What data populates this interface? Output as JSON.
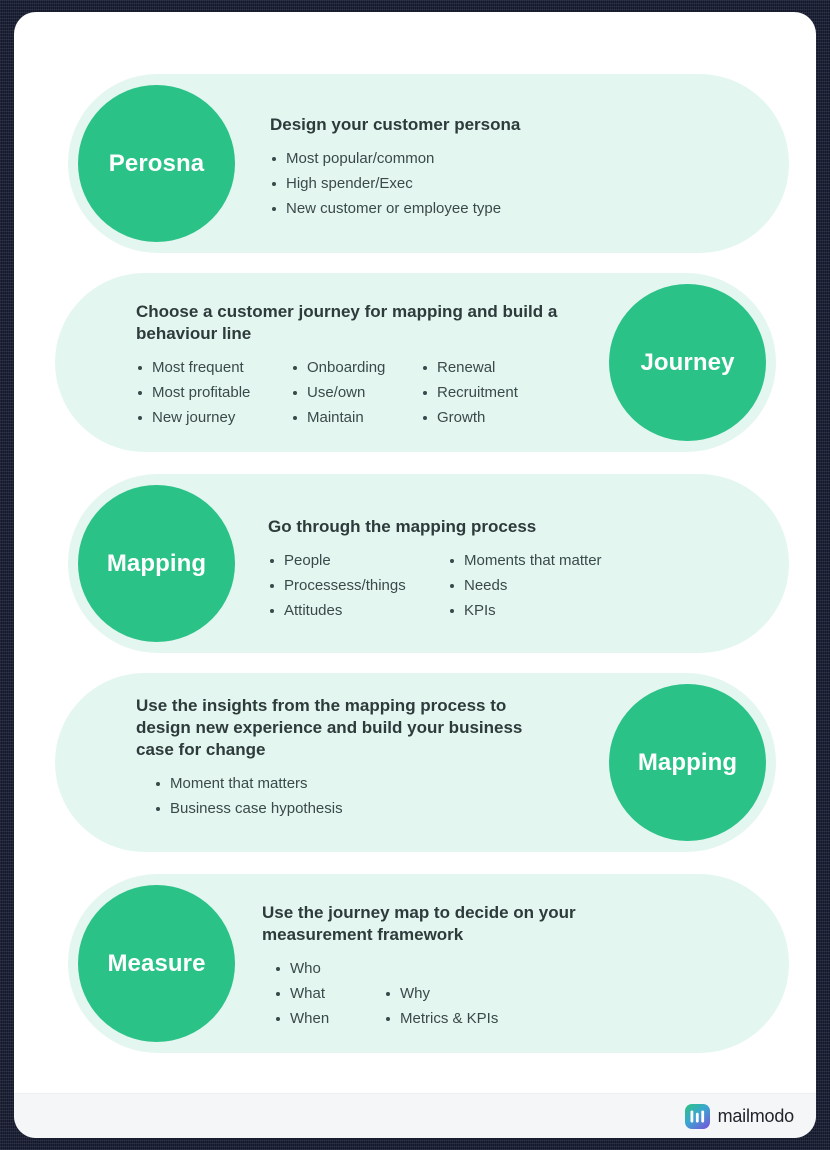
{
  "document": {
    "type": "infographic",
    "theme": {
      "accent_green": "#2ac287",
      "panel_bg": "#e4f6f0",
      "page_bg": "#ffffff",
      "heading_color": "#2d3b3b",
      "body_color": "#3a4a4a",
      "footer_bg": "#f5f6f7"
    }
  },
  "sections": [
    {
      "badge": "Perosna",
      "badge_side": "left",
      "title": "Design your customer persona",
      "columns": [
        {
          "items": [
            "Most popular/common",
            "High spender/Exec",
            "New customer or employee type"
          ]
        }
      ]
    },
    {
      "badge": "Journey",
      "badge_side": "right",
      "title": "Choose a customer journey for mapping and build a behaviour line",
      "columns": [
        {
          "items": [
            "Most frequent",
            "Most profitable",
            "New journey"
          ]
        },
        {
          "items": [
            "Onboarding",
            "Use/own",
            "Maintain"
          ]
        },
        {
          "items": [
            "Renewal",
            "Recruitment",
            "Growth"
          ]
        }
      ]
    },
    {
      "badge": "Mapping",
      "badge_side": "left",
      "title": "Go through the mapping process",
      "columns": [
        {
          "items": [
            "People",
            "Processess/things",
            "Attitudes"
          ]
        },
        {
          "items": [
            "Moments that matter",
            "Needs",
            "KPIs"
          ]
        }
      ]
    },
    {
      "badge": "Mapping",
      "badge_side": "right",
      "title": "Use the insights from the mapping process to design new experience and build your business case for change",
      "columns": [
        {
          "items": [
            "Moment that matters",
            "Business case hypothesis"
          ]
        }
      ]
    },
    {
      "badge": "Measure",
      "badge_side": "left",
      "title": "Use the journey map to decide on your measurement framework",
      "columns": [
        {
          "items": [
            "Who",
            "What",
            "When"
          ]
        },
        {
          "items": [
            "",
            "Why",
            "Metrics & KPIs"
          ]
        }
      ]
    }
  ],
  "footer": {
    "brand_name": "mailmodo",
    "brand_icon": "mailmodo-logo-icon"
  }
}
